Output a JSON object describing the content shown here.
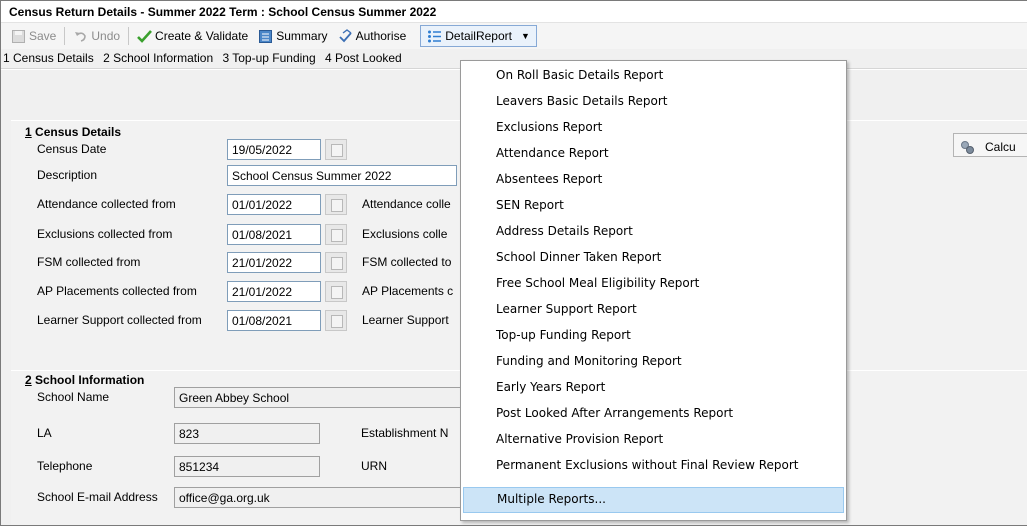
{
  "window": {
    "title": "Census Return Details - Summer 2022 Term : School Census Summer 2022"
  },
  "toolbar": {
    "save": "Save",
    "undo": "Undo",
    "create_validate": "Create & Validate",
    "summary": "Summary",
    "authorise": "Authorise",
    "detail_report": "DetailReport"
  },
  "nav": {
    "items": [
      "1 Census Details",
      "2 School Information",
      "3 Top-up Funding",
      "4 Post Looked"
    ]
  },
  "census": {
    "title_num": "1",
    "title": "Census Details",
    "census_date_label": "Census Date",
    "census_date": "19/05/2022",
    "description_label": "Description",
    "description": "School Census Summer 2022",
    "attendance_from_label": "Attendance collected from",
    "attendance_from": "01/01/2022",
    "attendance_to_label": "Attendance colle",
    "exclusions_from_label": "Exclusions collected from",
    "exclusions_from": "01/08/2021",
    "exclusions_to_label": "Exclusions colle",
    "fsm_from_label": "FSM collected from",
    "fsm_from": "21/01/2022",
    "fsm_to_label": "FSM collected to",
    "ap_from_label": "AP Placements collected from",
    "ap_from": "21/01/2022",
    "ap_to_label": "AP Placements c",
    "ls_from_label": "Learner Support collected from",
    "ls_from": "01/08/2021",
    "ls_to_label": "Learner Support"
  },
  "school": {
    "title_num": "2",
    "title": "School Information",
    "name_label": "School Name",
    "name": "Green Abbey School",
    "la_label": "LA",
    "la": "823",
    "estab_label": "Establishment N",
    "phone_label": "Telephone",
    "phone": "851234",
    "urn_label": "URN",
    "email_label": "School E-mail Address",
    "email": "office@ga.org.uk"
  },
  "calc_button": "Calcu",
  "menu": {
    "items": [
      "On Roll Basic Details Report",
      "Leavers Basic Details Report",
      "Exclusions Report",
      "Attendance Report",
      "Absentees Report",
      "SEN Report",
      "Address Details Report",
      "School Dinner Taken Report",
      "Free School Meal Eligibility Report",
      "Learner Support Report",
      "Top-up Funding Report",
      "Funding and Monitoring Report",
      "Early Years Report",
      "Post Looked After Arrangements Report",
      "Alternative Provision Report",
      "Permanent Exclusions without Final Review Report",
      "Multiple Reports..."
    ],
    "selected_index": 16
  }
}
